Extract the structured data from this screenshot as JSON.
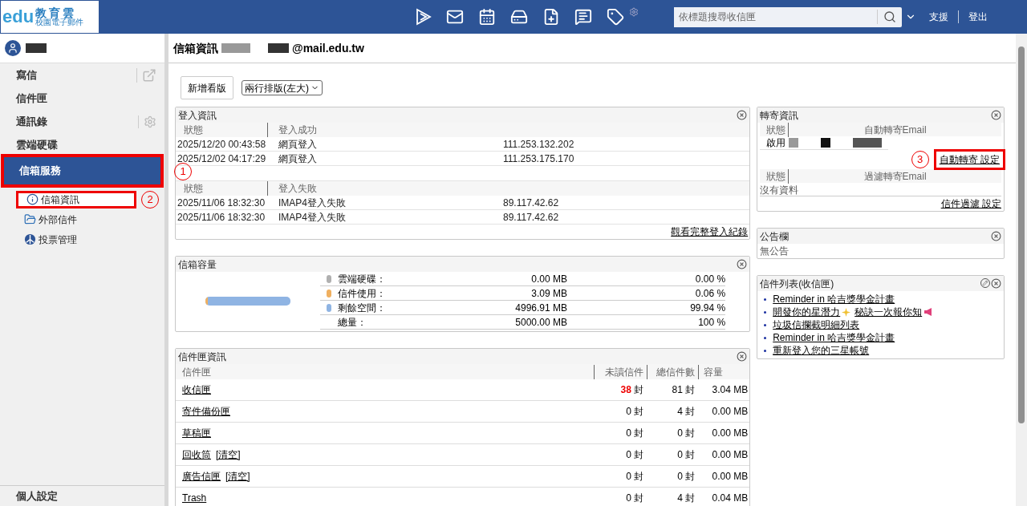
{
  "logo": {
    "title": "教育雲",
    "subtitle": "校園電子郵件",
    "mark": "edu"
  },
  "topbar": {
    "search": {
      "placeholder": "依標題搜尋收信匣"
    },
    "links": [
      "支援",
      "登出"
    ]
  },
  "sidebar": {
    "items": [
      {
        "label": "寫信",
        "kind": "external",
        "selected": false,
        "highlighted": false
      },
      {
        "label": "信件匣",
        "kind": "plain",
        "selected": false,
        "highlighted": false
      },
      {
        "label": "通訊錄",
        "kind": "gear",
        "selected": false,
        "highlighted": false
      },
      {
        "label": "雲端硬碟",
        "kind": "plain",
        "selected": false,
        "highlighted": false
      },
      {
        "label": "信箱服務",
        "kind": "plain",
        "selected": true,
        "highlighted": true
      }
    ],
    "subitems": [
      {
        "label": "信箱資訊",
        "kind": "info",
        "highlighted": true,
        "callout": "2"
      },
      {
        "label": "外部信件",
        "kind": "folder",
        "highlighted": false
      },
      {
        "label": "投票管理",
        "kind": "vote",
        "highlighted": false
      }
    ],
    "footer": "個人設定"
  },
  "page": {
    "title": "信箱資訊",
    "address": "@mail.edu.tw",
    "add_button": "新增看版",
    "layout_select": "兩行排版(左大)"
  },
  "login_panel": {
    "title": "登入資訊",
    "callout": "1",
    "sections": [
      {
        "headers": [
          "狀態",
          "登入成功"
        ],
        "rows": [
          [
            "2025/12/20 00:43:58",
            "網頁登入",
            "111.253.132.202"
          ],
          [
            "2025/12/02 04:17:29",
            "網頁登入",
            "111.253.175.170"
          ]
        ]
      },
      {
        "headers": [
          "狀態",
          "登入失敗"
        ],
        "rows": [
          [
            "2025/11/06 18:32:30",
            "IMAP4登入失敗",
            "89.117.42.62"
          ],
          [
            "2025/11/06 18:32:30",
            "IMAP4登入失敗",
            "89.117.42.62"
          ]
        ]
      }
    ],
    "link": "觀看完整登入紀錄"
  },
  "capacity_panel": {
    "title": "信箱容量",
    "level": 0.0006,
    "items": [
      {
        "label": "雲端硬碟：",
        "size": "0.00 MB",
        "percent": "0.00 %",
        "color": "#b0b0b0"
      },
      {
        "label": "信件使用：",
        "size": "3.09 MB",
        "percent": "0.06 %",
        "color": "#f0b060"
      },
      {
        "label": "剩餘空間：",
        "size": "4996.91 MB",
        "percent": "99.94 %",
        "color": "#8fb4e3"
      },
      {
        "label": "總量：",
        "size": "5000.00 MB",
        "percent": "100 %"
      }
    ]
  },
  "folder_panel": {
    "title": "信件匣資訊",
    "columns": [
      "信件匣",
      "未讀信件",
      "總信件數",
      "容量"
    ],
    "rows": [
      {
        "name": "收信匣",
        "unread": "38",
        "unread_unit": "封",
        "total": "81 封",
        "size": "3.04 MB",
        "has_unread": true
      },
      {
        "name": "寄件備份匣",
        "unread": "0",
        "unread_unit": "封",
        "total": "4 封",
        "size": "0.00 MB",
        "has_unread": false
      },
      {
        "name": "草稿匣",
        "unread": "0",
        "unread_unit": "封",
        "total": "0 封",
        "size": "0.00 MB",
        "has_unread": false
      },
      {
        "name": "回收筒",
        "clear": "[清空]",
        "unread": "0",
        "unread_unit": "封",
        "total": "0 封",
        "size": "0.00 MB",
        "has_unread": false
      },
      {
        "name": "廣告信匣",
        "clear": "[清空]",
        "unread": "0",
        "unread_unit": "封",
        "total": "0 封",
        "size": "0.00 MB",
        "has_unread": false
      },
      {
        "name": "Trash",
        "unread": "0",
        "unread_unit": "封",
        "total": "4 封",
        "size": "0.04 MB",
        "has_unread": false
      }
    ]
  },
  "forward_panel": {
    "title": "轉寄資訊",
    "auto_headers": [
      "狀態",
      "自動轉寄Email"
    ],
    "auto_status": "啟用",
    "auto_link": "自動轉寄 設定",
    "auto_link_highlighted": true,
    "callout": "3",
    "filter_headers": [
      "狀態",
      "過濾轉寄Email"
    ],
    "filter_empty": "沒有資料",
    "filter_link": "信件過濾 設定"
  },
  "notice_panel": {
    "title": "公告欄",
    "text": "無公告"
  },
  "maillist_panel": {
    "title": "信件列表(收信匣)",
    "items": [
      {
        "kind": "plain",
        "parts": [
          "Reminder in 哈吉獎學金計畫"
        ]
      },
      {
        "kind": "decorated",
        "parts": [
          "開發你的星潛力",
          "秘訣一次報你知"
        ]
      },
      {
        "kind": "plain",
        "parts": [
          "垃圾信攔截明細列表"
        ]
      },
      {
        "kind": "plain",
        "parts": [
          "Reminder in 哈吉獎學金計畫"
        ]
      },
      {
        "kind": "plain",
        "parts": [
          "重新登入您的三星帳號"
        ]
      }
    ]
  }
}
